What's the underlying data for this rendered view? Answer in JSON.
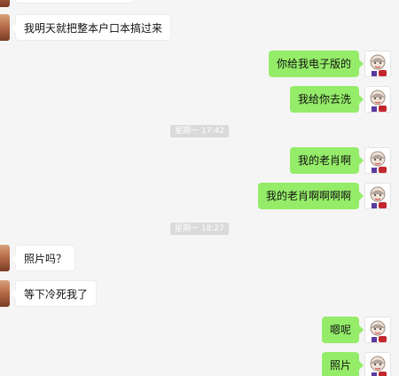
{
  "messages": [
    {
      "side": "left",
      "text": "我明天就把整本户口本搞过来"
    },
    {
      "side": "right",
      "text": "你给我电子版的"
    },
    {
      "side": "right",
      "text": "我给你去洗"
    },
    {
      "side": "time",
      "text": "星期一 17:42"
    },
    {
      "side": "right",
      "text": "我的老肖啊"
    },
    {
      "side": "right",
      "text": "我的老肖啊啊啊啊"
    },
    {
      "side": "time",
      "text": "星期一 18:27"
    },
    {
      "side": "left",
      "text": "照片吗？"
    },
    {
      "side": "left",
      "text": "等下冷死我了"
    },
    {
      "side": "right",
      "text": "嗯呢"
    },
    {
      "side": "right",
      "text": "照片"
    }
  ],
  "colors": {
    "background": "#f5f5f5",
    "self_bubble": "#95ec69",
    "other_bubble": "#ffffff",
    "timestamp_bg": "#dadada"
  }
}
